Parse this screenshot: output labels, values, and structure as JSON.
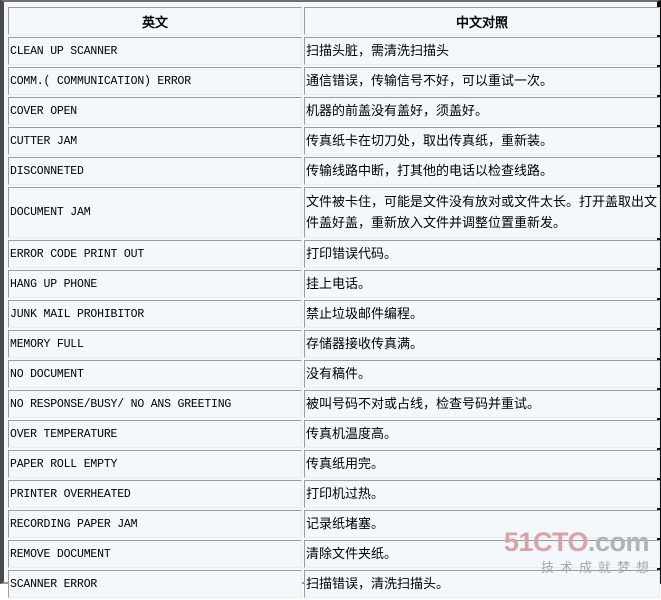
{
  "table": {
    "headers": {
      "english": "英文",
      "chinese": "中文对照"
    },
    "rows": [
      {
        "en": "CLEAN UP SCANNER",
        "zh": "扫描头脏，需清洗扫描头"
      },
      {
        "en": "COMM.( COMMUNICATION) ERROR",
        "zh": "通信错误，传输信号不好，可以重试一次。"
      },
      {
        "en": "COVER OPEN",
        "zh": "机器的前盖没有盖好，须盖好。"
      },
      {
        "en": "CUTTER JAM",
        "zh": "传真纸卡在切刀处，取出传真纸，重新装。"
      },
      {
        "en": "DISCONNETED",
        "zh": "传输线路中断，打其他的电话以检查线路。"
      },
      {
        "en": "DOCUMENT JAM",
        "zh": "文件被卡住，可能是文件没有放对或文件太长。打开盖取出文件盖好盖，重新放入文件并调整位置重新发。"
      },
      {
        "en": "ERROR CODE PRINT OUT",
        "zh": "打印错误代码。"
      },
      {
        "en": "HANG UP PHONE",
        "zh": "挂上电话。"
      },
      {
        "en": "JUNK MAIL PROHIBITOR",
        "zh": "禁止垃圾邮件编程。"
      },
      {
        "en": "MEMORY FULL",
        "zh": "存储器接收传真满。"
      },
      {
        "en": "NO DOCUMENT",
        "zh": "没有稿件。"
      },
      {
        "en": "NO RESPONSE/BUSY/ NO ANS GREETING",
        "zh": "被叫号码不对或占线，检查号码并重试。"
      },
      {
        "en": "OVER TEMPERATURE",
        "zh": "传真机温度高。"
      },
      {
        "en": "PAPER ROLL EMPTY",
        "zh": "传真纸用完。"
      },
      {
        "en": "PRINTER OVERHEATED",
        "zh": "打印机过热。"
      },
      {
        "en": "RECORDING PAPER JAM",
        "zh": "记录纸堵塞。"
      },
      {
        "en": "REMOVE DOCUMENT",
        "zh": "清除文件夹纸。"
      },
      {
        "en": "SCANNER ERROR",
        "zh": "扫描错误，清洗扫描头。"
      }
    ]
  },
  "watermark": {
    "brand": "51CTO",
    "tld": ".com",
    "tagline": "技术成就梦想"
  },
  "colors": {
    "cell_background": "#f3f8fd",
    "cell_border": "#9c9c9c",
    "watermark_brand": "#d9a3a6",
    "watermark_tld": "#b3b3b3"
  }
}
